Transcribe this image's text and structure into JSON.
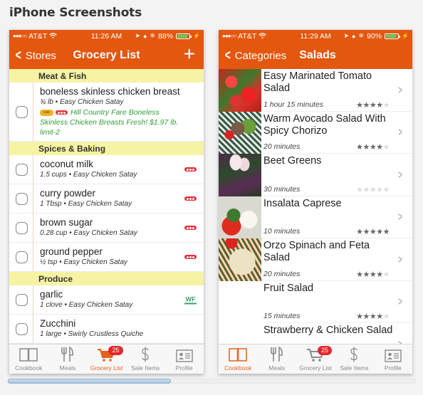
{
  "page": {
    "heading": "iPhone Screenshots"
  },
  "screens": [
    {
      "status": {
        "carrier": "AT&T",
        "time": "11:26 AM",
        "battery": "88%",
        "battery_level": 0.88
      },
      "nav": {
        "back_label": "Stores",
        "title": "Grocery List",
        "action_icon": "plus-icon"
      },
      "sections": [
        {
          "title": "Meat & Fish",
          "items": [
            {
              "name": "boneless skinless chicken breast",
              "detail": "¾ lb • Easy Chicken Satay",
              "sale_text": "Hill Country Fare Boneless Skinless Chicken Breasts Fresh! $1.97 lb. limit-2",
              "checked": false
            }
          ]
        },
        {
          "title": "Spices & Baking",
          "items": [
            {
              "name": "coconut milk",
              "detail": "1.5 cups • Easy Chicken Satay",
              "store": "heb-icon",
              "checked": false
            },
            {
              "name": "curry powder",
              "detail": "1 Tbsp • Easy Chicken Satay",
              "store": "heb-icon",
              "checked": false
            },
            {
              "name": "brown sugar",
              "detail": "0.28 cup • Easy Chicken Satay",
              "store": "heb-icon",
              "checked": false
            },
            {
              "name": "ground pepper",
              "detail": "½ tsp • Easy Chicken Satay",
              "store": "heb-icon",
              "checked": false
            }
          ]
        },
        {
          "title": "Produce",
          "items": [
            {
              "name": "garlic",
              "detail": "1 clove • Easy Chicken Satay",
              "store": "whole-foods-icon",
              "checked": false
            },
            {
              "name": "Zucchini",
              "detail": "1 large • Swirly Crustless Quiche",
              "checked": false
            }
          ]
        }
      ],
      "tabs": [
        {
          "label": "Cookbook",
          "icon": "book-icon",
          "active": false
        },
        {
          "label": "Meals",
          "icon": "fork-knife-icon",
          "active": false
        },
        {
          "label": "Grocery List",
          "icon": "cart-icon",
          "active": true,
          "badge": "25"
        },
        {
          "label": "Sale Items",
          "icon": "dollar-icon",
          "active": false
        },
        {
          "label": "Profile",
          "icon": "profile-card-icon",
          "active": false
        }
      ]
    },
    {
      "status": {
        "carrier": "AT&T",
        "time": "11:29 AM",
        "battery": "90%",
        "battery_level": 0.9
      },
      "nav": {
        "back_label": "Categories",
        "title": "Salads"
      },
      "recipes": [
        {
          "name": "Easy Marinated Tomato Salad",
          "time": "1 hour 15 minutes",
          "rating": 4,
          "thumb": "tomato"
        },
        {
          "name": "Warm Avocado Salad With Spicy Chorizo",
          "time": "20 minutes",
          "rating": 4,
          "thumb": "avocado"
        },
        {
          "name": "Beet Greens",
          "time": "30 minutes",
          "rating": 0,
          "thumb": "beet"
        },
        {
          "name": "Insalata Caprese",
          "time": "10 minutes",
          "rating": 5,
          "thumb": "caprese"
        },
        {
          "name": "Orzo Spinach and Feta Salad",
          "time": "20 minutes",
          "rating": 4,
          "thumb": "orzo"
        },
        {
          "name": "Fruit Salad",
          "time": "15 minutes",
          "rating": 4,
          "thumb": ""
        },
        {
          "name": "Strawberry & Chicken Salad",
          "time": "",
          "rating": null,
          "thumb": ""
        }
      ],
      "tabs": [
        {
          "label": "Cookbook",
          "icon": "book-icon",
          "active": true
        },
        {
          "label": "Meals",
          "icon": "fork-knife-icon",
          "active": false
        },
        {
          "label": "Grocery List",
          "icon": "cart-icon",
          "active": false,
          "badge": "25"
        },
        {
          "label": "Sale Items",
          "icon": "dollar-icon",
          "active": false
        },
        {
          "label": "Profile",
          "icon": "profile-card-icon",
          "active": false
        }
      ]
    }
  ],
  "scrollbar": {
    "position": 0,
    "visible_fraction": 0.4
  },
  "colors": {
    "brand": "#e4570f",
    "section_bg": "#f6f3a4",
    "sale_text": "#2e9e36",
    "badge": "#e8242c",
    "active_tab": "#e4621a"
  }
}
